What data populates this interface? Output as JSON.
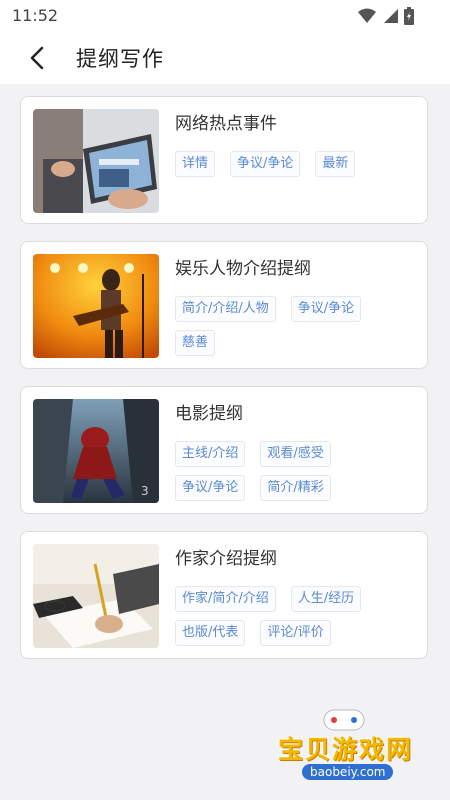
{
  "status_bar": {
    "time": "11:52"
  },
  "app_bar": {
    "title": "提纲写作"
  },
  "cards": [
    {
      "title": "网络热点事件",
      "tags": [
        "详情",
        "争议/争论",
        "最新"
      ]
    },
    {
      "title": "娱乐人物介绍提纲",
      "tags": [
        "简介/介绍/人物",
        "争议/争论",
        "慈善"
      ]
    },
    {
      "title": "电影提纲",
      "tags": [
        "主线/介绍",
        "观看/感受",
        "争议/争论",
        "简介/精彩"
      ]
    },
    {
      "title": "作家介绍提纲",
      "tags": [
        "作家/简介/介绍",
        "人生/经历",
        "也版/代表",
        "评论/评价"
      ]
    }
  ],
  "watermark": {
    "text": "宝贝游戏网",
    "url": "baobeiy.com"
  },
  "colors": {
    "tag_text": "#5b8ad3",
    "background": "#f2f2f4",
    "card": "#ffffff"
  }
}
